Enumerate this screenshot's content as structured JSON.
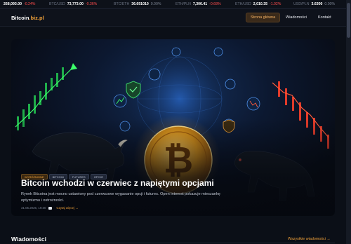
{
  "ticker": [
    {
      "label": "",
      "value": "268,093.00",
      "change": "-0.24%",
      "dir": "neg"
    },
    {
      "label": "BTC/USD",
      "value": "73,773.00",
      "change": "-0.36%",
      "dir": "neg"
    },
    {
      "label": "BTC/ETH",
      "value": "36.691010",
      "change": "0.00%",
      "dir": "flat"
    },
    {
      "label": "ETH/PLN",
      "value": "7,306.41",
      "change": "-0.68%",
      "dir": "neg"
    },
    {
      "label": "ETH/USD",
      "value": "2,010.35",
      "change": "-1.02%",
      "dir": "neg"
    },
    {
      "label": "USD/PLN",
      "value": "3.6300",
      "change": "0.00%",
      "dir": "flat"
    }
  ],
  "header": {
    "logo_main": "Bitcoin",
    "logo_accent": ".biz.pl",
    "nav": [
      {
        "label": "Strona główna",
        "active": true
      },
      {
        "label": "Wiadomości",
        "active": false
      },
      {
        "label": "Kontakt",
        "active": false
      }
    ]
  },
  "hero": {
    "tags": [
      {
        "label": "WYRÓŻNIONE",
        "style": "primary"
      },
      {
        "label": "BITCOIN",
        "style": "secondary"
      },
      {
        "label": "FUTURES",
        "style": "secondary"
      },
      {
        "label": "OPCJE",
        "style": "secondary"
      }
    ],
    "title": "Bitcoin wchodzi w czerwiec z napiętymi opcjami",
    "description": "Rynek Bitcoina jest mocno ustawiony pod czerwcowe wygasanie opcji i futures. Open interest pokazuje mieszankę optymizmu i ostrożności.",
    "date": "31.05.2026, 19:30",
    "read_more": "Czytaj więcej →",
    "icons": [
      "bitcoin-coin-icon",
      "bull-icon",
      "bear-icon",
      "shield-icon"
    ]
  },
  "section": {
    "title": "Wiadomości",
    "link": "Wszystkie wiadomości →"
  },
  "colors": {
    "accent": "#f0a13a",
    "negative": "#ff4d4d",
    "background": "#0b0f17"
  }
}
